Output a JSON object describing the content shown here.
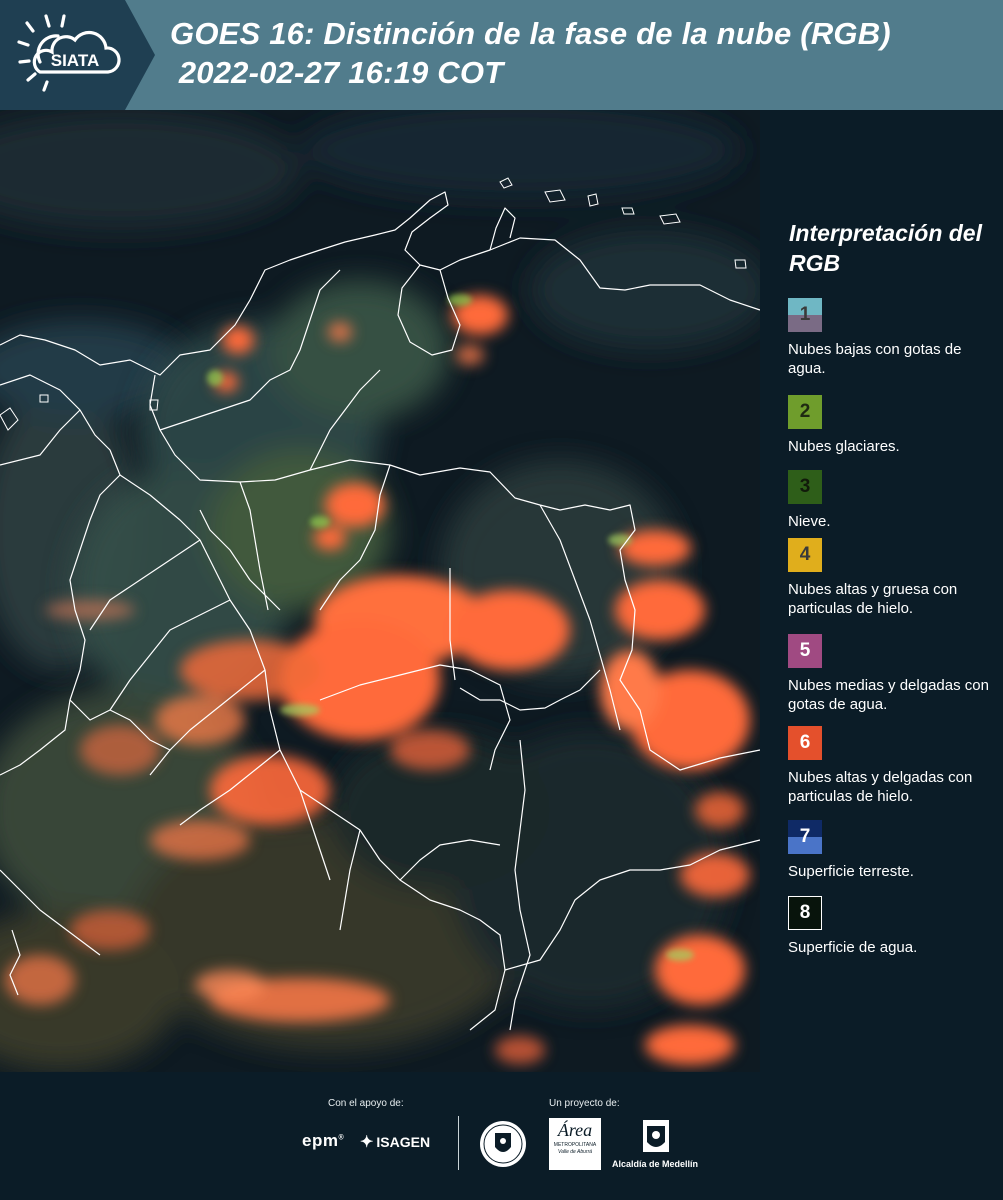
{
  "header": {
    "logo_text": "SIATA",
    "title_line1": "GOES 16: Distinción de la fase de la nube (RGB)",
    "title_line2": " 2022-02-27 16:19 COT"
  },
  "legend": {
    "title": "Interpretación del RGB",
    "items": [
      {
        "num": "1",
        "label": "Nubes bajas con gotas de agua.",
        "color_top": "#6fb7c4",
        "color_bottom": "#7a6b85",
        "num_color": "#3a3a3a"
      },
      {
        "num": "2",
        "label": "Nubes glaciares.",
        "color_top": "#6f9d2c",
        "color_bottom": "#6f9d2c",
        "num_color": "#1f2a12"
      },
      {
        "num": "3",
        "label": "Nieve.",
        "color_top": "#2e5e19",
        "color_bottom": "#2e5e19",
        "num_color": "#111a0a"
      },
      {
        "num": "4",
        "label": "Nubes altas y gruesa con particulas de hielo.",
        "color_top": "#e0ae1c",
        "color_bottom": "#e0ae1c",
        "num_color": "#3a3a3a"
      },
      {
        "num": "5",
        "label": "Nubes medias y delgadas con gotas de agua.",
        "color_top": "#a04a82",
        "color_bottom": "#a04a82",
        "num_color": "#ffffff"
      },
      {
        "num": "6",
        "label": "Nubes altas y delgadas con particulas de hielo.",
        "color_top": "#e4502c",
        "color_bottom": "#e4502c",
        "num_color": "#ffffff"
      },
      {
        "num": "7",
        "label": "Superficie terreste.",
        "color_top": "#0f2a66",
        "color_bottom": "#4a74c8",
        "num_color": "#ffffff"
      },
      {
        "num": "8",
        "label": "Superficie de agua.",
        "color_top": "#08140c",
        "color_bottom": "#08140c",
        "num_color": "#ffffff"
      }
    ]
  },
  "footer": {
    "support_label": "Con el apoyo de:",
    "project_label": "Un proyecto de:",
    "sponsor1": "epm",
    "sponsor1_sup": "®",
    "sponsor2": "ISAGEN",
    "partner_area": "Área",
    "partner_area_sub1": "METROPOLITANA",
    "partner_area_sub2": "Valle de Aburrá",
    "partner_alcaldia": "Alcaldía de Medellín"
  },
  "colors": {
    "header_bg": "#517c8c",
    "page_bg": "#0b1c27",
    "cloud_orange": "#ff6a3a"
  }
}
